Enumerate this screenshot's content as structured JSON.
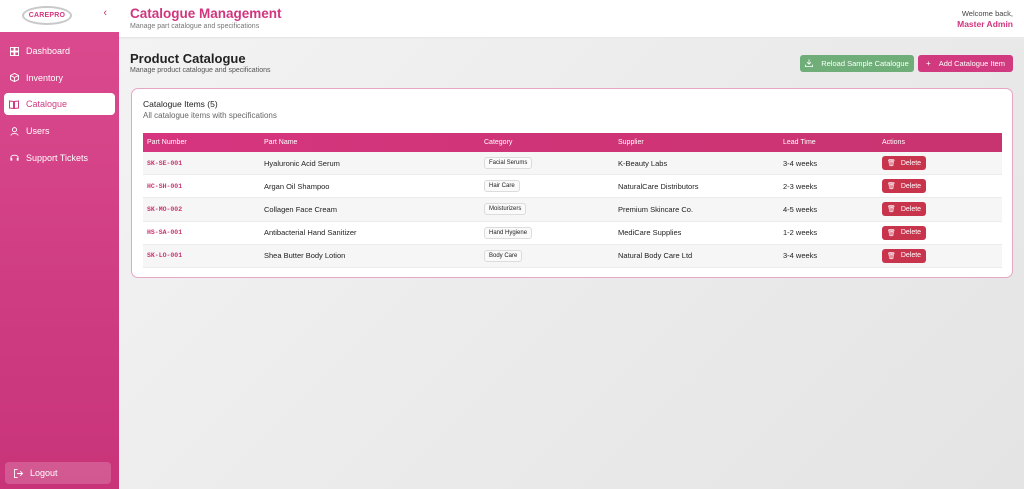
{
  "sidebar": {
    "logo_text": "CAREPRO",
    "collapse_icon": "chevron-left-icon",
    "items": [
      {
        "label": "Dashboard",
        "icon": "dashboard-icon"
      },
      {
        "label": "Inventory",
        "icon": "box-icon"
      },
      {
        "label": "Catalogue",
        "icon": "book-icon",
        "active": true
      },
      {
        "label": "Users",
        "icon": "user-icon"
      },
      {
        "label": "Support Tickets",
        "icon": "headset-icon"
      }
    ],
    "logout_label": "Logout"
  },
  "header": {
    "title": "Catalogue Management",
    "subtitle": "Manage part catalogue and specifications",
    "welcome": "Welcome back,",
    "user_name": "Master Admin"
  },
  "page": {
    "title": "Product Catalogue",
    "subtitle": "Manage product catalogue and specifications",
    "reload_button": "Reload Sample Catalogue",
    "add_button": "Add Catalogue Item"
  },
  "catalogue": {
    "title": "Catalogue Items (5)",
    "subtitle": "All catalogue items with specifications",
    "columns": [
      "Part Number",
      "Part Name",
      "Category",
      "Supplier",
      "Lead Time",
      "Actions"
    ],
    "delete_label": "Delete",
    "rows": [
      {
        "part_number": "SK-SE-001",
        "part_name": "Hyaluronic Acid Serum",
        "category": "Facial Serums",
        "supplier": "K-Beauty Labs",
        "lead_time": "3-4 weeks"
      },
      {
        "part_number": "HC-SH-001",
        "part_name": "Argan Oil Shampoo",
        "category": "Hair Care",
        "supplier": "NaturalCare Distributors",
        "lead_time": "2-3 weeks"
      },
      {
        "part_number": "SK-MO-002",
        "part_name": "Collagen Face Cream",
        "category": "Moisturizers",
        "supplier": "Premium Skincare Co.",
        "lead_time": "4-5 weeks"
      },
      {
        "part_number": "HS-SA-001",
        "part_name": "Antibacterial Hand Sanitizer",
        "category": "Hand Hygiene",
        "supplier": "MediCare Supplies",
        "lead_time": "1-2 weeks"
      },
      {
        "part_number": "SK-LO-001",
        "part_name": "Shea Butter Body Lotion",
        "category": "Body Care",
        "supplier": "Natural Body Care Ltd",
        "lead_time": "3-4 weeks"
      }
    ]
  },
  "colors": {
    "brand": "#d0357e",
    "sidebar": "#cf3c82",
    "reload_button": "#6fae78",
    "delete_button": "#c9344d"
  }
}
